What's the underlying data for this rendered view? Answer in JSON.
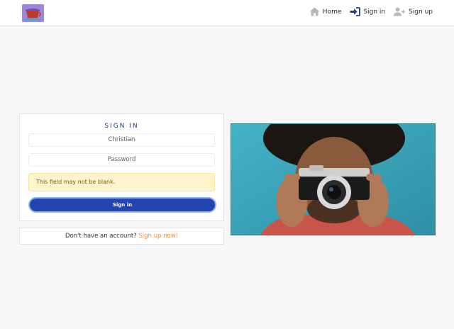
{
  "nav": {
    "home": "Home",
    "signin": "Sign in",
    "signup": "Sign up"
  },
  "signin": {
    "title": "SIGN IN",
    "username_value": "Christian",
    "password_placeholder": "Password",
    "error": "This field may not be blank.",
    "button": "Sign in"
  },
  "signup_prompt": {
    "text": "Don't have an account?",
    "link": "Sign up now!"
  },
  "colors": {
    "primary": "#2445b0",
    "link": "#f08a3e",
    "alert_bg": "#fff4cc"
  },
  "icons": [
    "logo",
    "home-icon",
    "sign-in-icon",
    "add-user-icon"
  ]
}
